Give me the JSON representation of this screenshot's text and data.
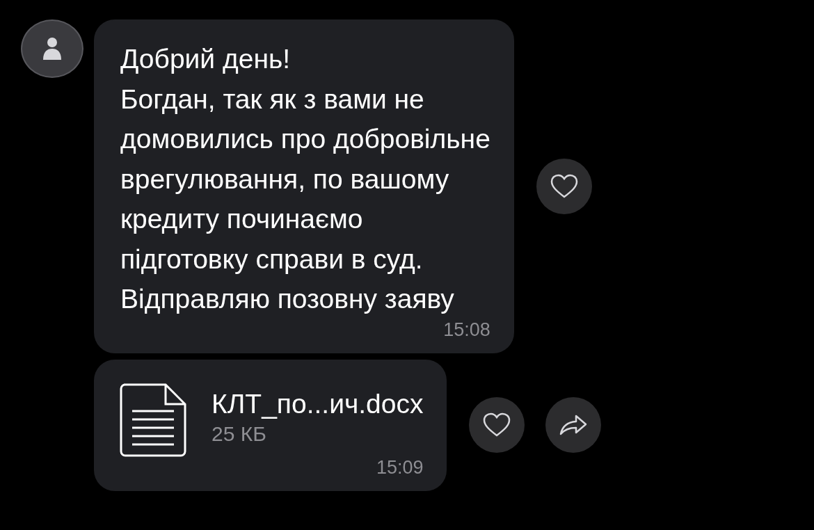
{
  "messages": [
    {
      "kind": "text",
      "sender": {
        "kind": "avatar"
      },
      "text": "Добрий день!\nБогдан, так як з вами не\nдомовились про добровільне\nврегулювання, по вашому\nкредиту починаємо\nпідготовку справи в суд.\nВідправляю позовну заяву",
      "time": "15:08",
      "actions": [
        {
          "kind": "like"
        }
      ]
    },
    {
      "kind": "file",
      "file_name": "КЛТ_по...ич.docx",
      "file_size": "25 КБ",
      "time": "15:09",
      "actions": [
        {
          "kind": "like"
        },
        {
          "kind": "forward"
        }
      ]
    }
  ]
}
